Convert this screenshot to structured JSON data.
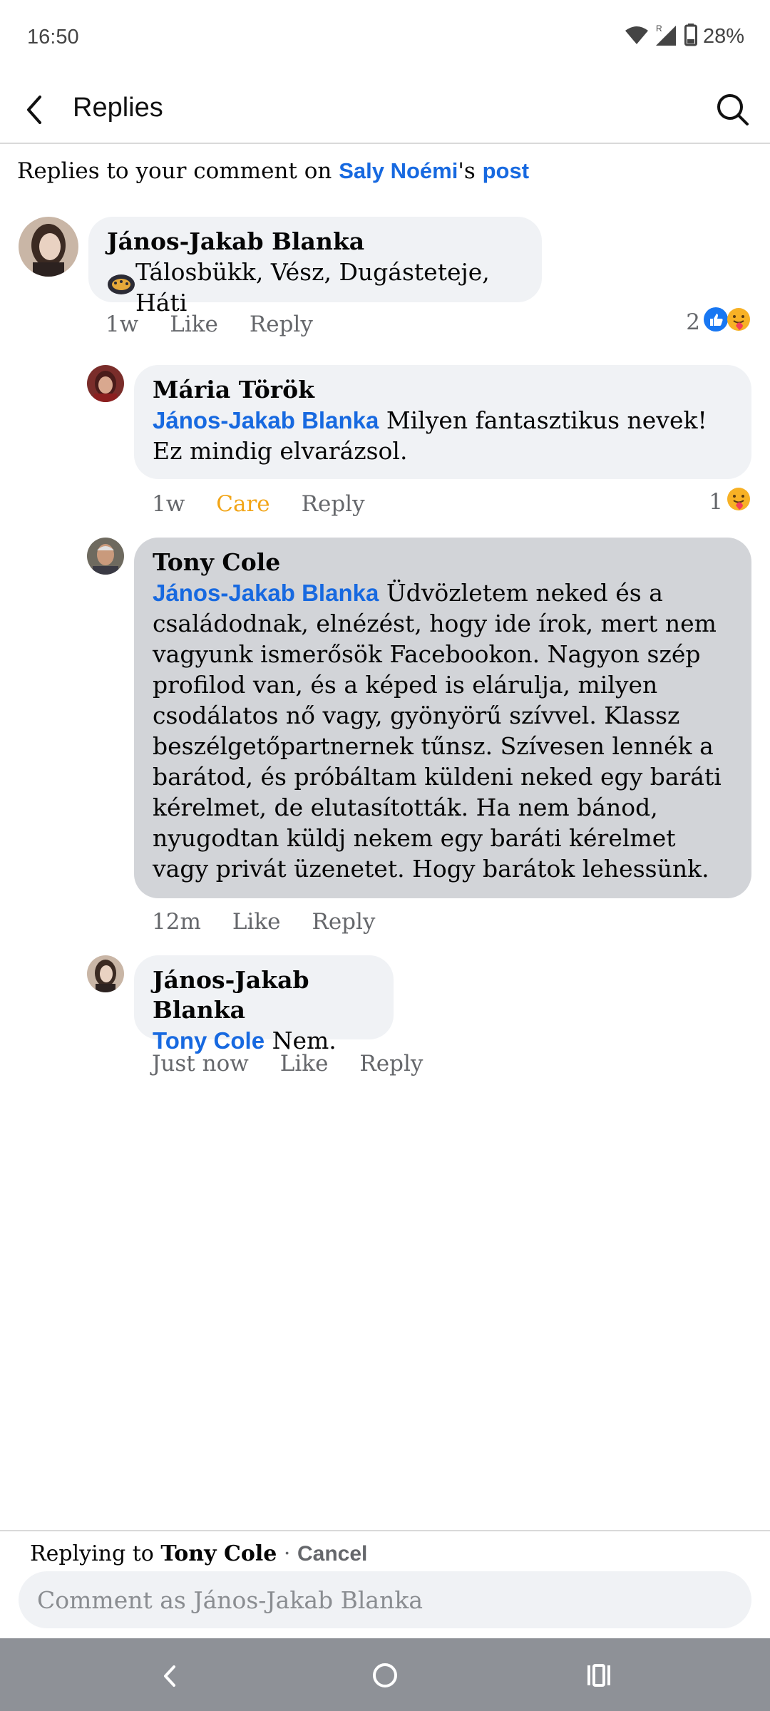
{
  "status": {
    "time": "16:50",
    "battery": "28%"
  },
  "header": {
    "title": "Replies"
  },
  "context": {
    "prefix": "Replies to your comment on ",
    "author": "Saly Noémi",
    "possessive": "'s ",
    "post_link": "post"
  },
  "root_comment": {
    "name": "János-Jakab Blanka",
    "text": "Tálosbükk, Vész, Dugásteteje, Háti",
    "time": "1w",
    "like": "Like",
    "reply": "Reply",
    "reaction_count": "2"
  },
  "replies": [
    {
      "name": "Mária Török",
      "mention": "János-Jakab Blanka",
      "text": " Milyen fantasztikus nevek! Ez mindig elvarázsol.",
      "time": "1w",
      "like": "Care",
      "reply": "Reply",
      "reaction_count": "1"
    },
    {
      "name": "Tony Cole",
      "mention": "János-Jakab Blanka",
      "text": "Üdvözletem neked és a családodnak, elnézést, hogy ide írok, mert nem vagyunk ismerősök Facebookon. Nagyon szép profilod van, és a képed is elárulja, milyen csodálatos nő vagy, gyönyörű szívvel. Klassz beszélgetőpartnernek tűnsz. Szívesen lennék a barátod, és próbáltam küldeni neked egy baráti kérelmet, de elutasították. Ha nem bánod, nyugodtan küldj nekem egy baráti kérelmet vagy privát üzenetet. Hogy barátok lehessünk.",
      "time": "12m",
      "like": "Like",
      "reply": "Reply"
    },
    {
      "name": "János-Jakab Blanka",
      "mention": "Tony Cole",
      "text": "Nem.",
      "time": "Just now",
      "like": "Like",
      "reply": "Reply"
    }
  ],
  "reply_bar": {
    "replying_prefix": "Replying to ",
    "replying_to": "Tony Cole",
    "separator": "·",
    "cancel": "Cancel",
    "placeholder": "Comment as János-Jakab Blanka"
  },
  "colors": {
    "link": "#1769e0",
    "care": "#f2a517",
    "bubble": "#f0f2f5",
    "highlight": "#d2d4d8",
    "nav": "#8e9197"
  }
}
